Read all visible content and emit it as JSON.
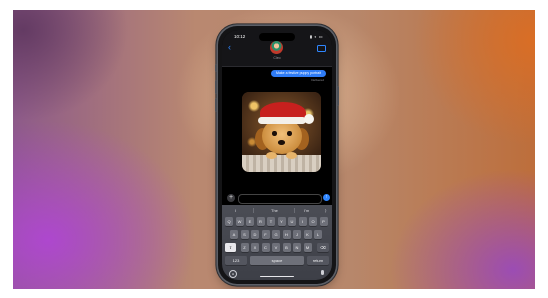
{
  "status_bar": {
    "time": "10:12",
    "icons": "▮ ◐ ▭"
  },
  "conversation": {
    "back_glyph": "‹",
    "contact_name": "Cleo",
    "outgoing_message": "Make a festive puppy portrait",
    "delivered_label": "Delivered",
    "image_alt": "AI-generated puppy wearing a Santa hat"
  },
  "composer": {
    "plus_glyph": "+",
    "send_glyph": "↑"
  },
  "keyboard": {
    "predictions": [
      "I",
      "The",
      "I'm"
    ],
    "expand_glyph": "⟩",
    "row1": [
      "Q",
      "W",
      "E",
      "R",
      "T",
      "Y",
      "U",
      "I",
      "O",
      "P"
    ],
    "row2": [
      "A",
      "S",
      "D",
      "F",
      "G",
      "H",
      "J",
      "K",
      "L"
    ],
    "row3": [
      "Z",
      "X",
      "C",
      "V",
      "B",
      "N",
      "M"
    ],
    "shift_glyph": "⇧",
    "delete_glyph": "⌫",
    "numbers_key": "123",
    "space_key": "space",
    "return_key": "return",
    "globe_glyph": "⊕"
  },
  "colors": {
    "accent": "#2f86ff",
    "keyboard_bg": "#45474f",
    "key_bg": "#6e7079"
  }
}
